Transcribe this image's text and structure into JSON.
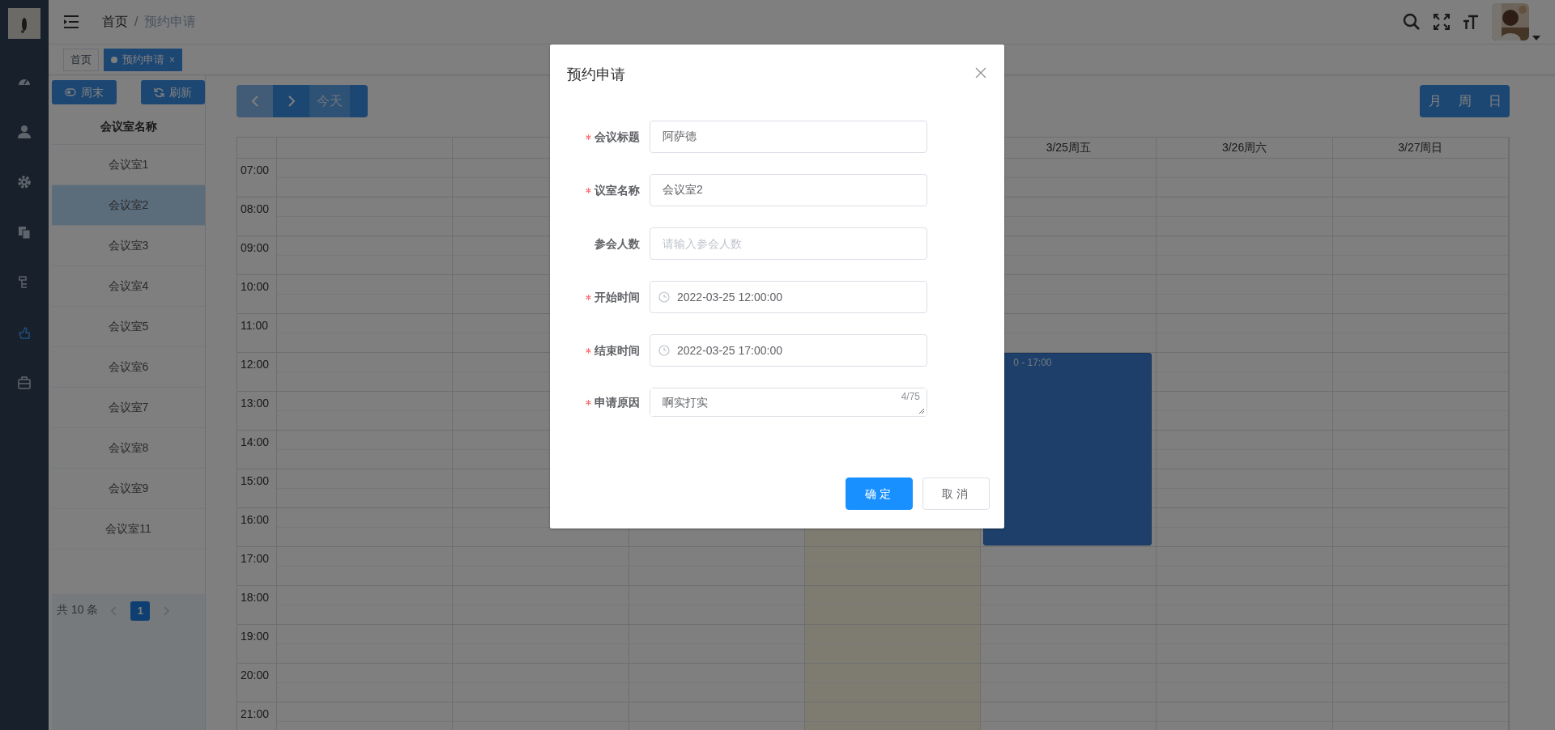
{
  "sidebar": {
    "items": [
      {
        "selected": false
      },
      {
        "selected": false
      },
      {
        "selected": false
      },
      {
        "selected": false
      },
      {
        "selected": false
      },
      {
        "selected": true
      },
      {
        "selected": false
      }
    ]
  },
  "header": {
    "breadcrumb": [
      {
        "label": "首页",
        "current": false
      },
      {
        "label": "预约申请",
        "current": true
      }
    ],
    "separator": "/"
  },
  "tabs": [
    {
      "label": "首页",
      "selected": false
    },
    {
      "label": "预约申请",
      "selected": true,
      "close": "×"
    }
  ],
  "room_panel": {
    "buttons": [
      {
        "label": "周末",
        "kind": "toggle"
      },
      {
        "label": "刷新",
        "kind": "refresh"
      }
    ],
    "header": "会议室名称",
    "rooms": [
      {
        "name": "会议室1",
        "selected": false
      },
      {
        "name": "会议室2",
        "selected": true
      },
      {
        "name": "会议室3",
        "selected": false
      },
      {
        "name": "会议室4",
        "selected": false
      },
      {
        "name": "会议室5",
        "selected": false
      },
      {
        "name": "会议室6",
        "selected": false
      },
      {
        "name": "会议室7",
        "selected": false
      },
      {
        "name": "会议室8",
        "selected": false
      },
      {
        "name": "会议室9",
        "selected": false
      },
      {
        "name": "会议室11",
        "selected": false
      }
    ],
    "pagination": {
      "total": "共 10 条",
      "pages": [
        {
          "label": "1",
          "selected": true
        }
      ]
    }
  },
  "calendar": {
    "today_button": "今天",
    "views": [
      {
        "label": "月"
      },
      {
        "label": "周"
      },
      {
        "label": "日"
      }
    ],
    "days": [
      {
        "today": false
      },
      {
        "today": false
      },
      {
        "today": false
      },
      {
        "today": true
      },
      {
        "label": "3/25周五",
        "today": false,
        "booked": [
          false,
          false,
          false,
          false,
          false,
          true,
          true,
          true,
          true,
          true,
          false,
          false,
          false,
          false,
          false
        ],
        "event_text": "0 - 17:00"
      },
      {
        "label": "3/26周六",
        "today": false
      },
      {
        "label": "3/27周日",
        "today": false
      }
    ],
    "hours": [
      "07:00",
      "08:00",
      "09:00",
      "10:00",
      "11:00",
      "12:00",
      "13:00",
      "14:00",
      "15:00",
      "16:00",
      "17:00",
      "18:00",
      "19:00",
      "20:00",
      "21:00"
    ]
  },
  "modal": {
    "title": "预约申请",
    "fields": [
      {
        "label": "会议标题",
        "required": true,
        "kind": "text",
        "value": "阿萨德"
      },
      {
        "label": "议室名称",
        "required": true,
        "kind": "text",
        "value": "会议室2"
      },
      {
        "label": "参会人数",
        "required": false,
        "kind": "text",
        "placeholder": "请输入参会人数"
      },
      {
        "label": "开始时间",
        "required": true,
        "kind": "datetime",
        "value": "2022-03-25 12:00:00"
      },
      {
        "label": "结束时间",
        "required": true,
        "kind": "datetime",
        "value": "2022-03-25 17:00:00"
      },
      {
        "label": "申请原因",
        "required": true,
        "kind": "textarea",
        "value": "啊实打实",
        "counter": "4/75"
      }
    ],
    "buttons": [
      {
        "label": "确定",
        "primary": true
      },
      {
        "label": "取消",
        "primary": false
      }
    ]
  }
}
